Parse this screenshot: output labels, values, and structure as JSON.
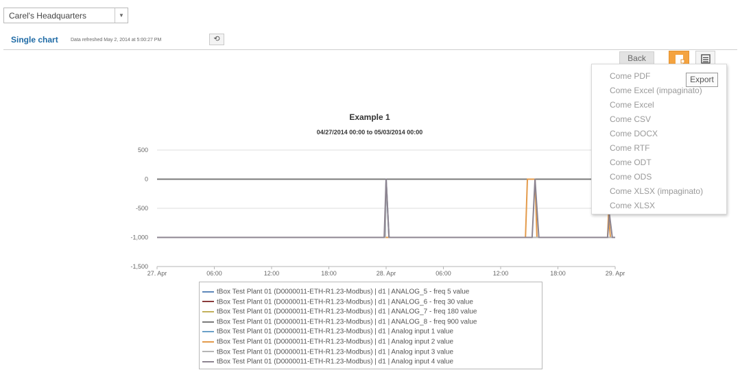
{
  "header": {
    "site_select_value": "Carel's Headquarters",
    "page_title": "Single chart",
    "refresh_text": "Data refreshed May 2, 2014 at 5:00:27 PM"
  },
  "toolbar": {
    "back_label": "Back",
    "export_tooltip": "Export",
    "export_icon": "export-file-icon",
    "table_icon": "table-view-icon"
  },
  "export_menu": [
    "Come PDF",
    "Come Excel (impaginato)",
    "Come Excel",
    "Come CSV",
    "Come DOCX",
    "Come RTF",
    "Come ODT",
    "Come ODS",
    "Come XLSX (impaginato)",
    "Come XLSX"
  ],
  "colors": {
    "accent_blue": "#1e6aa5",
    "export_orange": "#f4a340"
  },
  "chart_data": {
    "type": "line",
    "title": "Example 1",
    "subtitle": "04/27/2014 00:00 to 05/03/2014 00:00",
    "y_ticks": [
      "500",
      "0",
      "-500",
      "-1,000",
      "-1,500"
    ],
    "ylim": [
      -1500,
      500
    ],
    "x_ticks": [
      "27. Apr",
      "06:00",
      "12:00",
      "18:00",
      "28. Apr",
      "06:00",
      "12:00",
      "18:00",
      "29. Apr"
    ],
    "x_unit": "hours since 27. Apr 00:00",
    "xlim": [
      0,
      48
    ],
    "grid": "horizontal",
    "legend_position": "bottom",
    "series": [
      {
        "name": "tBox Test Plant 01 (D0000011-ETH-R1.23-Modbus) | d1 | ANALOG_5 - freq 5 value",
        "color": "#5c86b9",
        "points": [
          [
            0,
            0
          ],
          [
            48,
            0
          ]
        ]
      },
      {
        "name": "tBox Test Plant 01 (D0000011-ETH-R1.23-Modbus) | d1 | ANALOG_6 - freq 30 value",
        "color": "#8a3b3b",
        "points": [
          [
            0,
            0
          ],
          [
            48,
            0
          ]
        ]
      },
      {
        "name": "tBox Test Plant 01 (D0000011-ETH-R1.23-Modbus) | d1 | ANALOG_7 - freq 180 value",
        "color": "#c2b05a",
        "points": [
          [
            0,
            0
          ],
          [
            48,
            0
          ]
        ]
      },
      {
        "name": "tBox Test Plant 01 (D0000011-ETH-R1.23-Modbus) | d1 | ANALOG_8 - freq 900 value",
        "color": "#7a7a7a",
        "points": [
          [
            0,
            0
          ],
          [
            48,
            0
          ]
        ]
      },
      {
        "name": "tBox Test Plant 01 (D0000011-ETH-R1.23-Modbus) | d1 | Analog input 1 value",
        "color": "#6aa0c8",
        "points": [
          [
            0,
            -1000
          ],
          [
            23.9,
            -1000
          ],
          [
            24,
            0
          ],
          [
            24.3,
            -1000
          ],
          [
            48,
            -1000
          ]
        ]
      },
      {
        "name": "tBox Test Plant 01 (D0000011-ETH-R1.23-Modbus) | d1 | Analog input 2 value",
        "color": "#e39a4a",
        "points": [
          [
            0,
            -1000
          ],
          [
            38.6,
            -1000
          ],
          [
            38.8,
            0
          ],
          [
            39.6,
            0
          ],
          [
            39.8,
            -1000
          ],
          [
            47.2,
            -1000
          ],
          [
            47.3,
            -600
          ],
          [
            47.5,
            -1000
          ],
          [
            48,
            -1000
          ]
        ]
      },
      {
        "name": "tBox Test Plant 01 (D0000011-ETH-R1.23-Modbus) | d1 | Analog input 3 value",
        "color": "#b5b5b5",
        "points": [
          [
            0,
            -1000
          ],
          [
            23.9,
            -1000
          ],
          [
            24,
            0
          ],
          [
            24.3,
            -1000
          ],
          [
            48,
            -1000
          ]
        ]
      },
      {
        "name": "tBox Test Plant 01 (D0000011-ETH-R1.23-Modbus) | d1 | Analog input 4 value",
        "color": "#8c8490",
        "points": [
          [
            0,
            -1000
          ],
          [
            23.8,
            -1000
          ],
          [
            24,
            0
          ],
          [
            24.3,
            -1000
          ],
          [
            39.3,
            -1000
          ],
          [
            39.6,
            0
          ],
          [
            40,
            -1000
          ],
          [
            47.2,
            -1000
          ],
          [
            47.4,
            -600
          ],
          [
            47.7,
            -1000
          ],
          [
            48,
            -1000
          ]
        ]
      }
    ]
  }
}
